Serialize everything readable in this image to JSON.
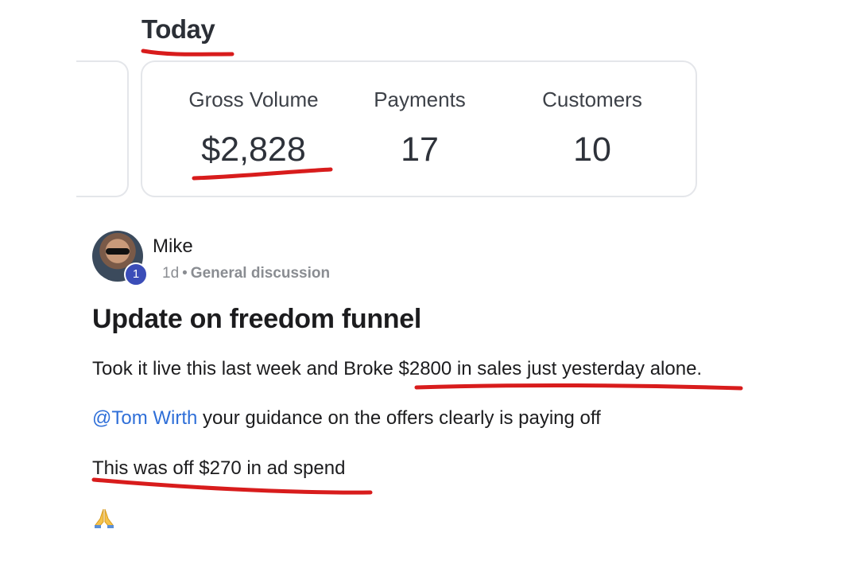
{
  "heading": "Today",
  "stats": [
    {
      "label": "Gross Volume",
      "value": "$2,828"
    },
    {
      "label": "Payments",
      "value": "17"
    },
    {
      "label": "Customers",
      "value": "10"
    }
  ],
  "post": {
    "author": "Mike",
    "badge": "1",
    "age": "1d",
    "separator": "•",
    "category": "General discussion",
    "title": "Update on freedom funnel",
    "line1_prefix": "Took it live this last week and Broke ",
    "line1_highlight": "$2800 in sales just yesterday alone.",
    "mention": "@Tom Wirth",
    "line2_rest": " your guidance on the offers clearly is paying off",
    "line3": "This was off $270 in ad spend",
    "emoji": "pray-emoji-icon"
  },
  "colors": {
    "underline": "#d81c1c",
    "mention": "#2f6fd8",
    "badge": "#3b4db8"
  }
}
